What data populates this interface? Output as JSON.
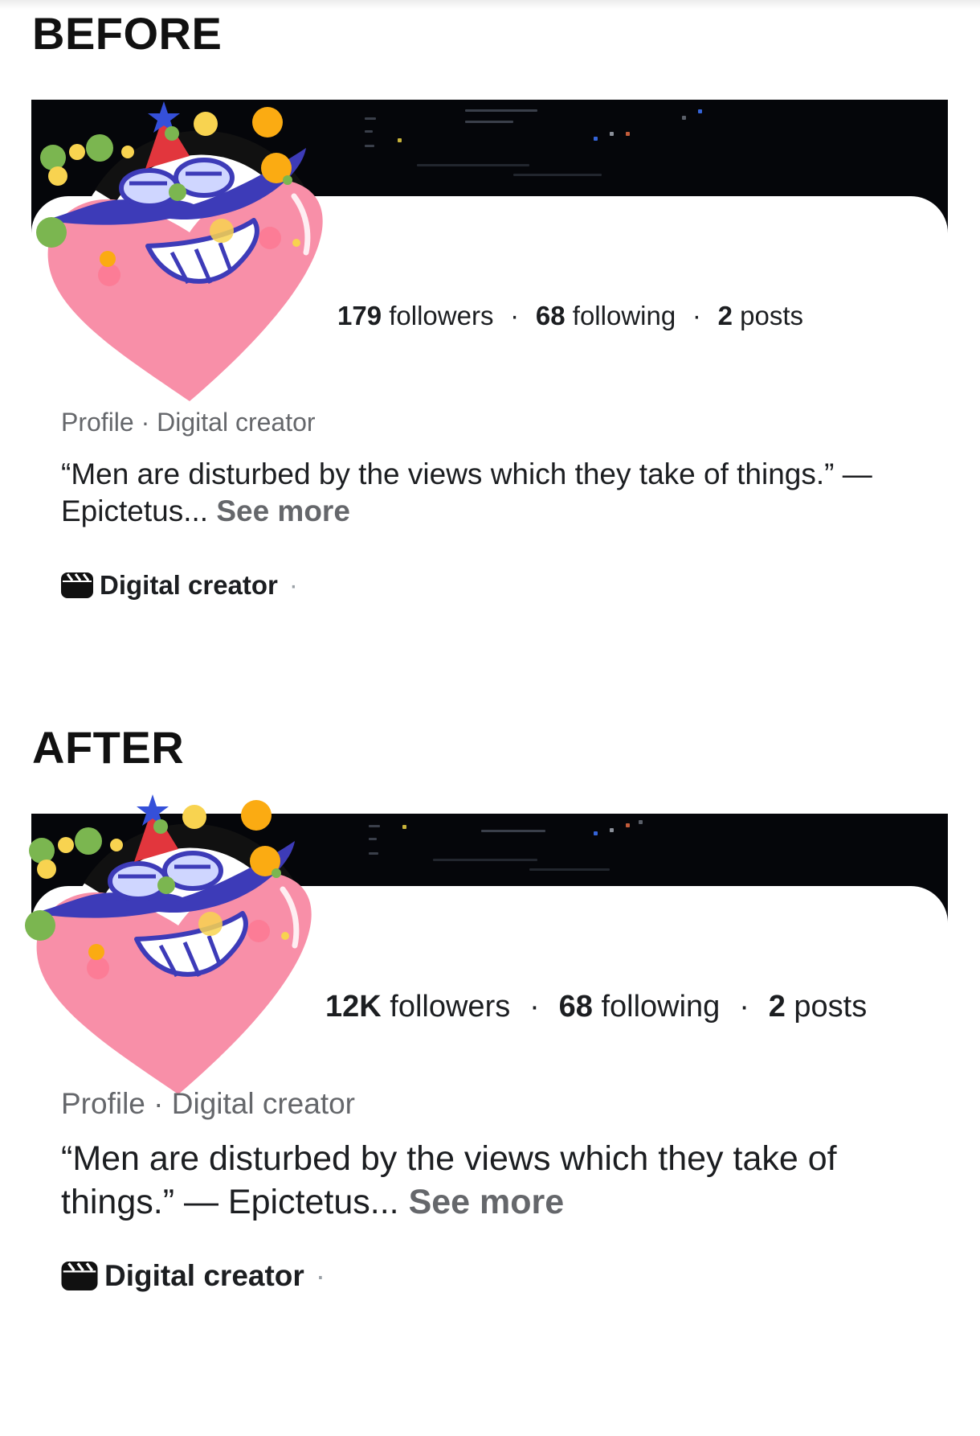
{
  "before": {
    "heading": "BEFORE",
    "stats": {
      "followers_count": "179",
      "followers_label": "followers",
      "sep1": "·",
      "following_count": "68",
      "following_label": "following",
      "sep2": "·",
      "posts_count": "2",
      "posts_label": "posts"
    },
    "meta": "Profile · Digital creator",
    "bio": {
      "text": "“Men are disturbed by the views which they take of things.” — Epictetus...",
      "see_more": "See more"
    },
    "category": {
      "icon": "clapperboard-icon",
      "label": "Digital creator",
      "trail": "·"
    }
  },
  "after": {
    "heading": "AFTER",
    "stats": {
      "followers_count": "12K",
      "followers_label": "followers",
      "sep1": "·",
      "following_count": "68",
      "following_label": "following",
      "sep2": "·",
      "posts_count": "2",
      "posts_label": "posts"
    },
    "meta": "Profile · Digital creator",
    "bio": {
      "text": "“Men are disturbed by the views which they take of things.” — Epictetus...",
      "see_more": "See more"
    },
    "category": {
      "icon": "clapperboard-icon",
      "label": "Digital creator",
      "trail": "·"
    }
  },
  "avatar": {
    "icon": "grinning-heart-avatar-icon",
    "colors": {
      "heart": "#f88fa8",
      "mustache": "#3d3bb8",
      "hat": "#e2363d",
      "star": "#3550d9",
      "confetti_green": "#7bb650",
      "confetti_yellow": "#f8d350",
      "confetti_orange": "#fbab12"
    }
  },
  "colors": {
    "cover": "#05060a",
    "text_primary": "#1c1e21",
    "text_secondary": "#65676b"
  }
}
